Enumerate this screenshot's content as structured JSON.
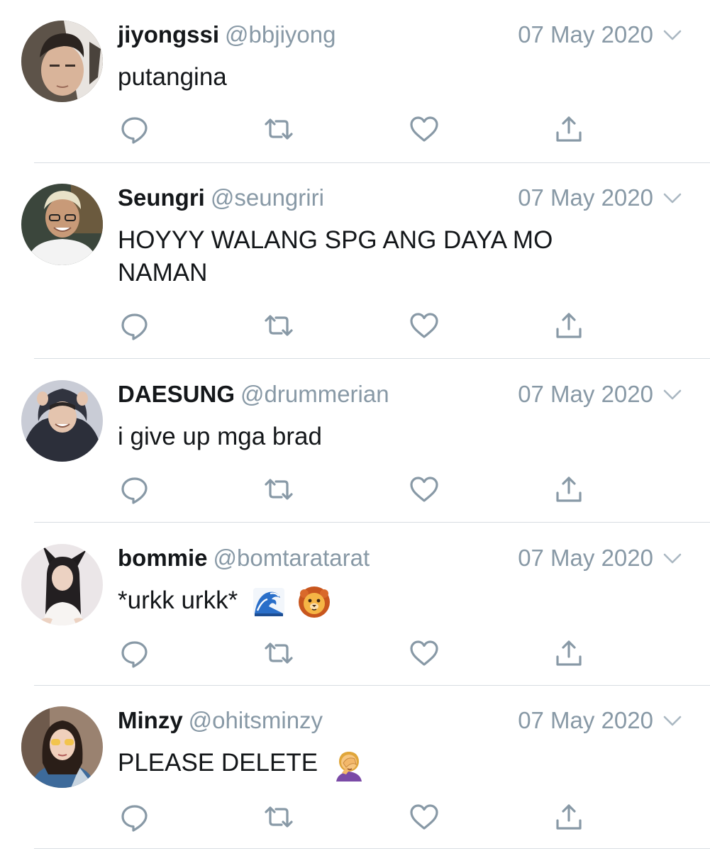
{
  "tweets": [
    {
      "name": "jiyongssi",
      "handle": "@bbjiyong",
      "date": "07 May 2020",
      "text": "putangina",
      "avatar_color": "#5a5048"
    },
    {
      "name": "Seungri",
      "handle": "@seungriri",
      "date": "07 May 2020",
      "text": "HOYYY WALANG SPG ANG DAYA MO NAMAN",
      "avatar_color": "#3a4a3e"
    },
    {
      "name": "DAESUNG",
      "handle": "@drummerian",
      "date": "07 May 2020",
      "text": "i give up mga brad",
      "avatar_color": "#2a2d38"
    },
    {
      "name": "bommie",
      "handle": "@bomtaratarat",
      "date": "07 May 2020",
      "text": "*urkk urkk*",
      "emojis": [
        "wave-emoji",
        "lion-face-emoji"
      ],
      "avatar_color": "#e9e4e6"
    },
    {
      "name": "Minzy",
      "handle": "@ohitsminzy",
      "date": "07 May 2020",
      "text": "PLEASE DELETE",
      "emojis": [
        "face-palm-emoji"
      ],
      "avatar_color": "#8c6a55"
    }
  ],
  "colors": {
    "icon_gray": "#8899a6",
    "text_dark": "#14171a",
    "divider": "#d8dde2"
  }
}
